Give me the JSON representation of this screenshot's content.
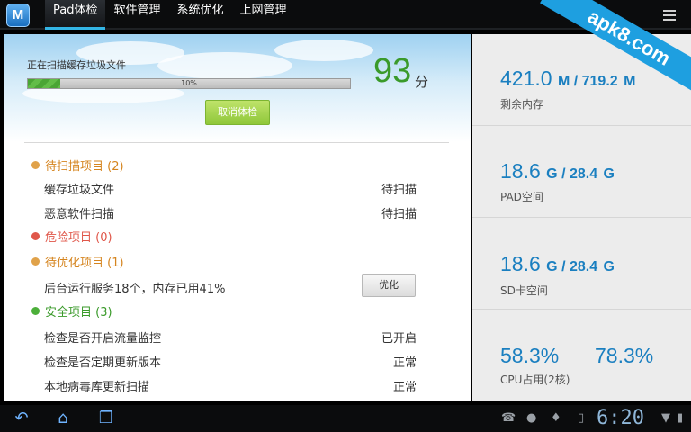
{
  "app": {
    "logo_letter": "M"
  },
  "tabs": [
    {
      "label": "Pad体检",
      "active": true
    },
    {
      "label": "软件管理"
    },
    {
      "label": "系统优化"
    },
    {
      "label": "上网管理"
    }
  ],
  "watermark": "apk8.com",
  "scan": {
    "status_text": "正在扫描缓存垃圾文件",
    "progress": 0.1,
    "progress_label": "10%",
    "score": "93",
    "score_unit": "分",
    "cancel_label": "取消体检"
  },
  "sections": {
    "pending": {
      "title": "待扫描项目 (2)",
      "items": [
        {
          "label": "缓存垃圾文件",
          "status": "待扫描"
        },
        {
          "label": "恶意软件扫描",
          "status": "待扫描"
        }
      ]
    },
    "danger": {
      "title": "危险项目 (0)"
    },
    "optimize": {
      "title": "待优化项目 (1)",
      "items": [
        {
          "label": "后台运行服务18个，内存已用41%",
          "button": "优化"
        }
      ]
    },
    "safe": {
      "title": "安全项目 (3)",
      "items": [
        {
          "label": "检查是否开启流量监控",
          "status": "已开启"
        },
        {
          "label": "检查是否定期更新版本",
          "status": "正常"
        },
        {
          "label": "本地病毒库更新扫描",
          "status": "正常"
        }
      ]
    }
  },
  "stats": {
    "memory": {
      "used": "421.0",
      "used_unit": "M",
      "total": "/ 719.2",
      "total_unit": "M",
      "label": "剩余内存"
    },
    "pad": {
      "used": "18.6",
      "used_unit": "G",
      "total": "/ 28.4",
      "total_unit": "G",
      "label": "PAD空间"
    },
    "sd": {
      "used": "18.6",
      "used_unit": "G",
      "total": "/ 28.4",
      "total_unit": "G",
      "label": "SD卡空间"
    },
    "cpu": {
      "v1": "58.3%",
      "v2": "78.3%",
      "label": "CPU占用(2核)"
    }
  },
  "system": {
    "clock": "6:20"
  },
  "colors": {
    "accent": "#1a7fc0",
    "score": "#3a9a2a",
    "pending": "#d5841e",
    "danger": "#e0574a",
    "safe": "#3a9a2a"
  }
}
